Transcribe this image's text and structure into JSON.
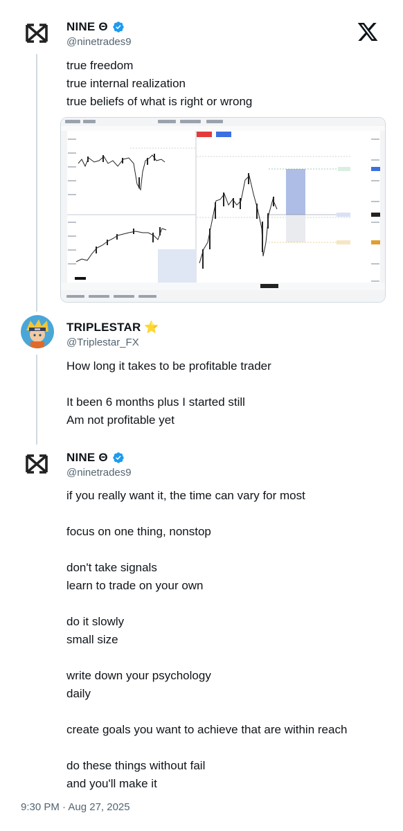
{
  "tweet1": {
    "author": {
      "name": "NINE Θ",
      "handle": "@ninetrades9"
    },
    "lines": [
      "true freedom",
      "true internal realization",
      "true beliefs of what is right or wrong"
    ]
  },
  "tweet2": {
    "author": {
      "name": "TRIPLESTAR ⭐",
      "handle": "@Triplestar_FX"
    },
    "lines": [
      "How long it takes to be profitable trader",
      "",
      "It been 6 months plus I started still",
      "Am not profitable yet"
    ]
  },
  "tweet3": {
    "author": {
      "name": "NINE Θ",
      "handle": "@ninetrades9"
    },
    "lines": [
      "if you really want it, the time can vary for most",
      "",
      "focus on one thing, nonstop",
      "",
      "don't take signals",
      "learn to trade on your own",
      "",
      "do it slowly",
      "small size",
      "",
      "write down your psychology",
      "daily",
      "",
      "create goals you want to achieve that are within reach",
      "",
      "do these things without fail",
      "and you'll make it"
    ]
  },
  "timestamp": "9:30 PM · Aug 27, 2025",
  "icons": {
    "logo": "x-logo-icon",
    "verified": "verified-badge-icon",
    "brand_avatar": "nine-logo-icon"
  },
  "colors": {
    "verified": "#1d9bf0",
    "text": "#0f1419",
    "secondary": "#536471",
    "thread_line": "#cfd9de"
  }
}
